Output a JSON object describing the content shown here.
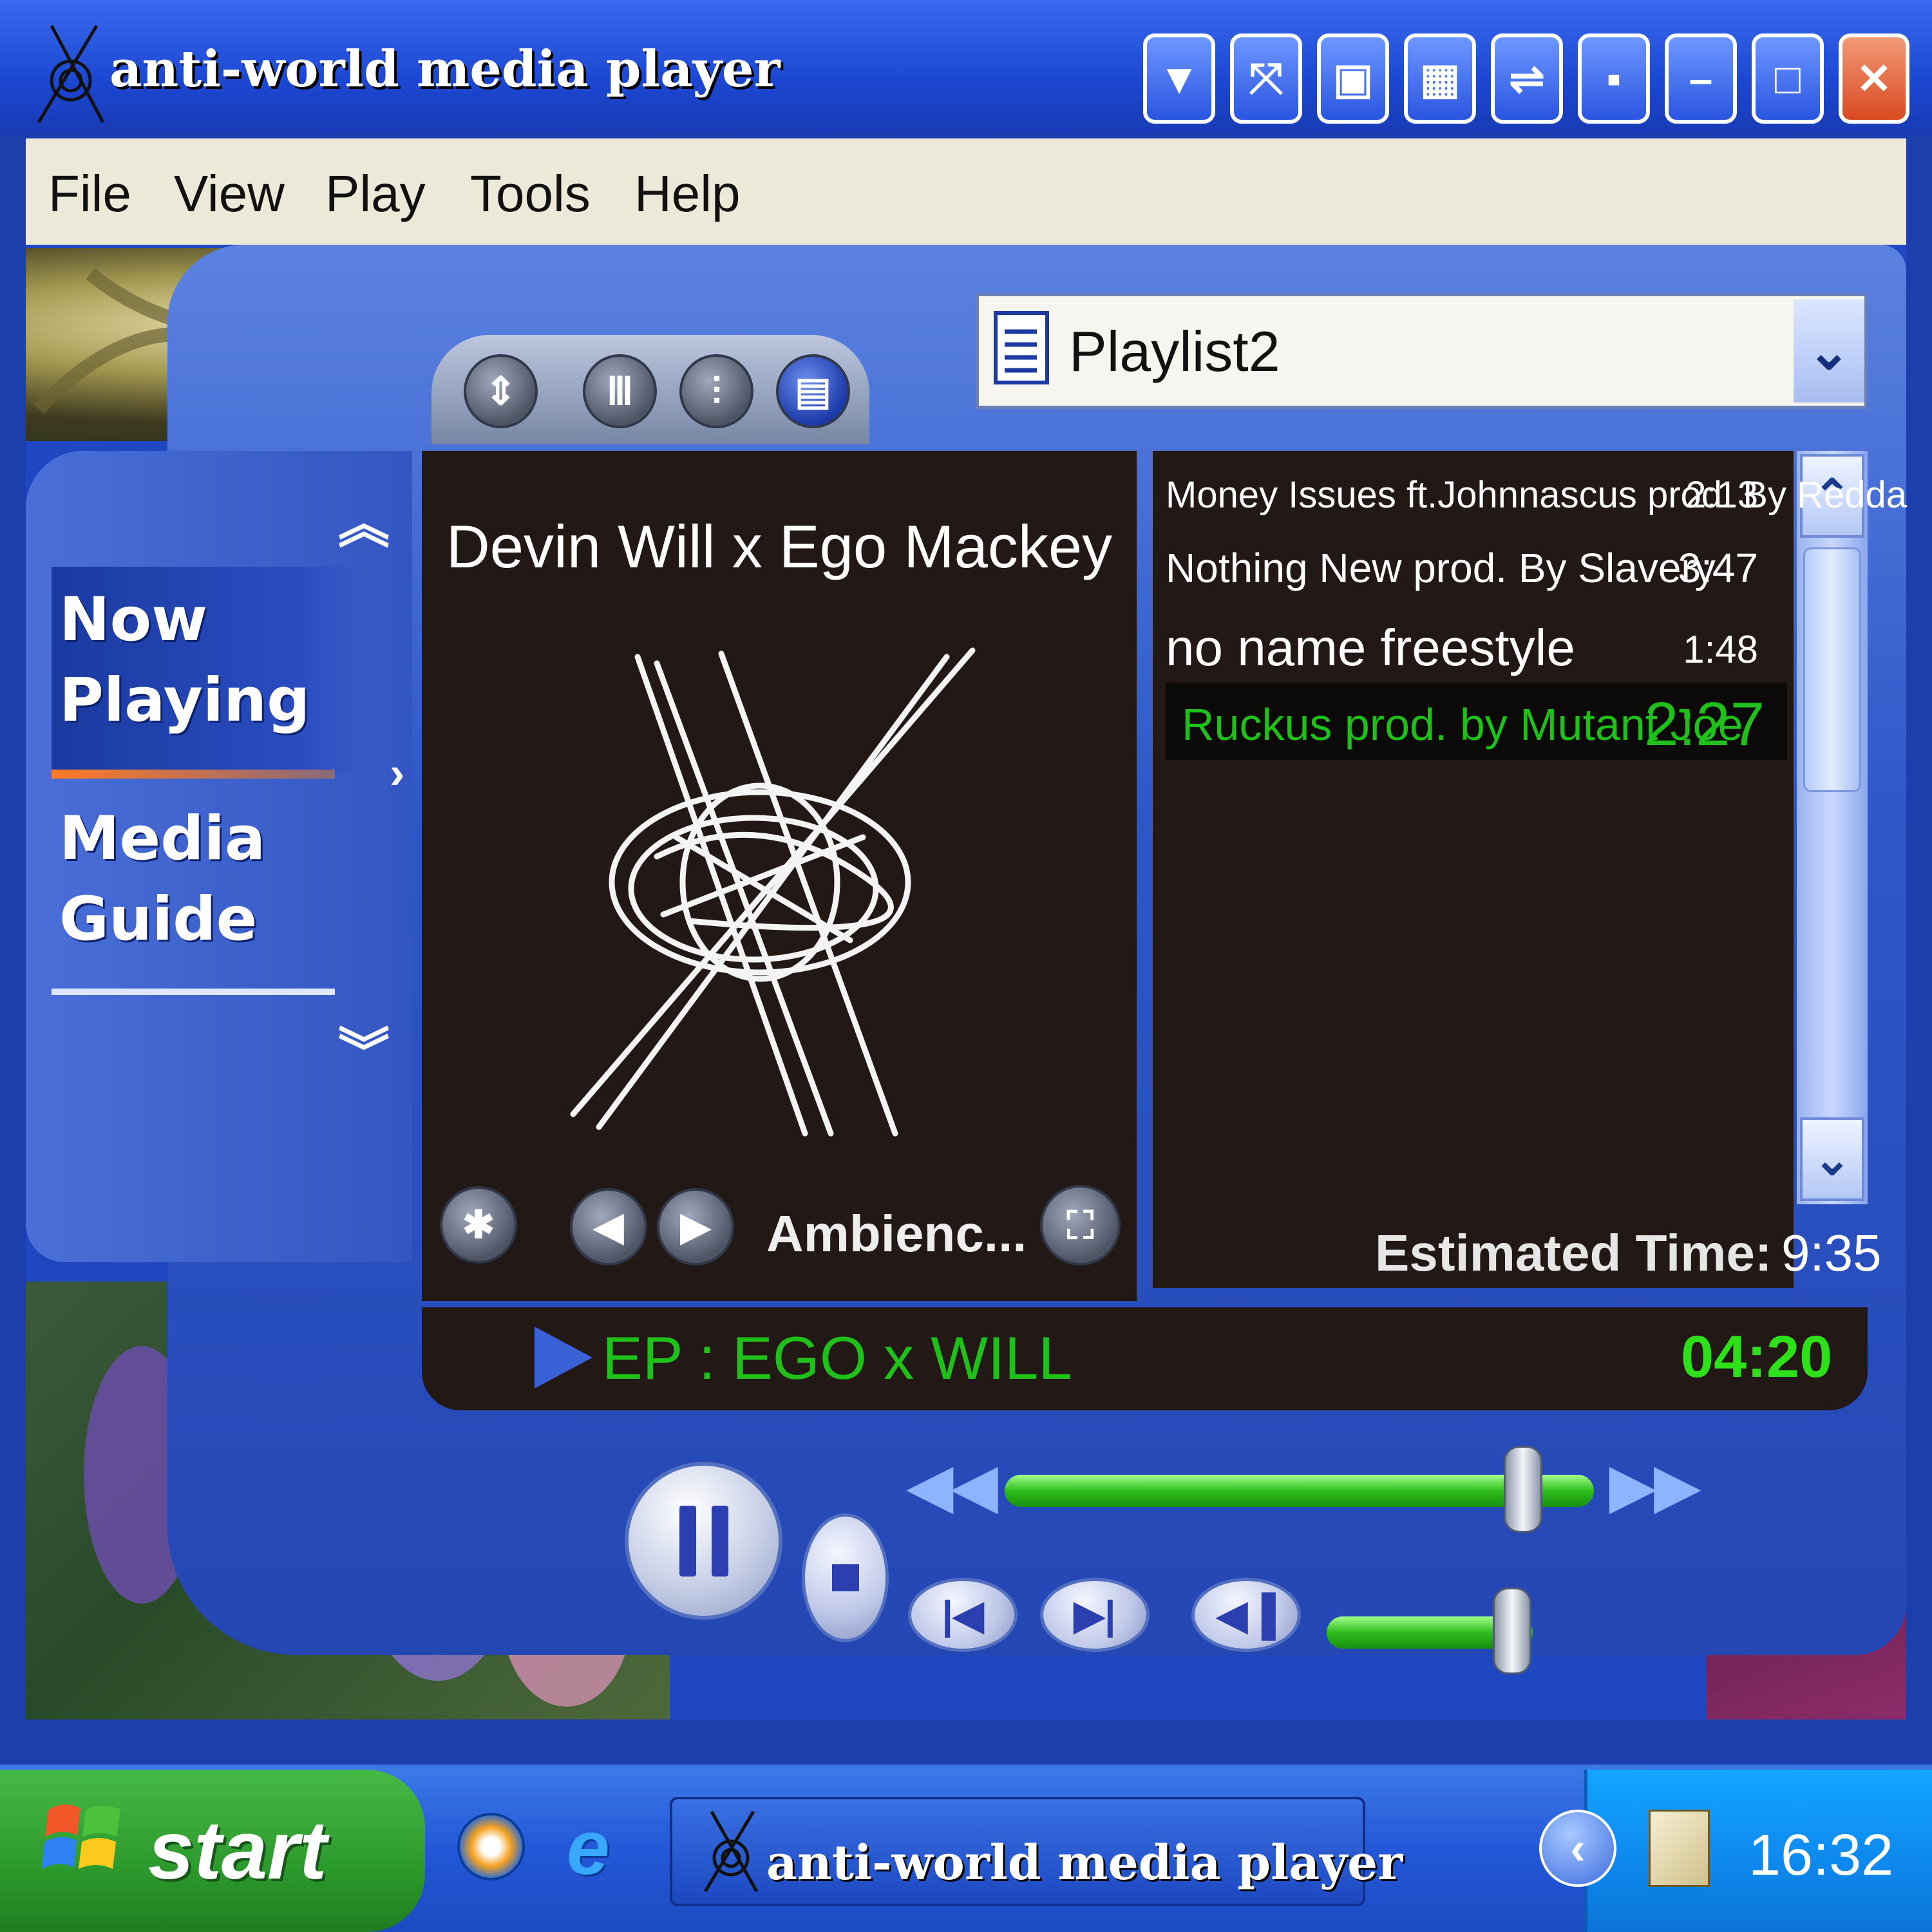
{
  "window": {
    "title": "anti-world media player",
    "buttons": [
      "▼",
      "⤧",
      "▣",
      "▦",
      "⇌",
      "▪",
      "–",
      "□",
      "✕"
    ]
  },
  "menu": [
    "File",
    "View",
    "Play",
    "Tools",
    "Help"
  ],
  "sidebar": {
    "now_playing": "Now Playing",
    "media_guide": "Media Guide",
    "up_icon": "double-chevron-up-icon",
    "down_icon": "double-chevron-down-icon"
  },
  "playlist_selector": {
    "label": "Playlist2"
  },
  "now_playing": {
    "artist": "Devin Will x Ego Mackey",
    "visualization": "Ambienc..."
  },
  "playlist": {
    "tracks": [
      {
        "title": "Money Issues ft.Johnnascus prod. By Redda",
        "duration": "2:13"
      },
      {
        "title": "Nothing New prod. By Slavery",
        "duration": "3:47"
      },
      {
        "title": "no name freestyle",
        "duration": "1:48"
      },
      {
        "title": "Ruckus prod. by Mutant Joe",
        "duration": "2:27",
        "active": true
      }
    ],
    "estimated_label": "Estimated Time:",
    "estimated_value": "9:35"
  },
  "status": {
    "title": "EP : EGO x WILL",
    "elapsed": "04:20"
  },
  "colors": {
    "accent_green": "#20c01a",
    "window_blue": "#1f47c2",
    "panel_dark": "#221917"
  },
  "transport": {
    "seek_fraction": 0.88,
    "volume_fraction": 0.9
  },
  "taskbar": {
    "start_label": "start",
    "task_title": "anti-world media player",
    "clock": "16:32"
  }
}
